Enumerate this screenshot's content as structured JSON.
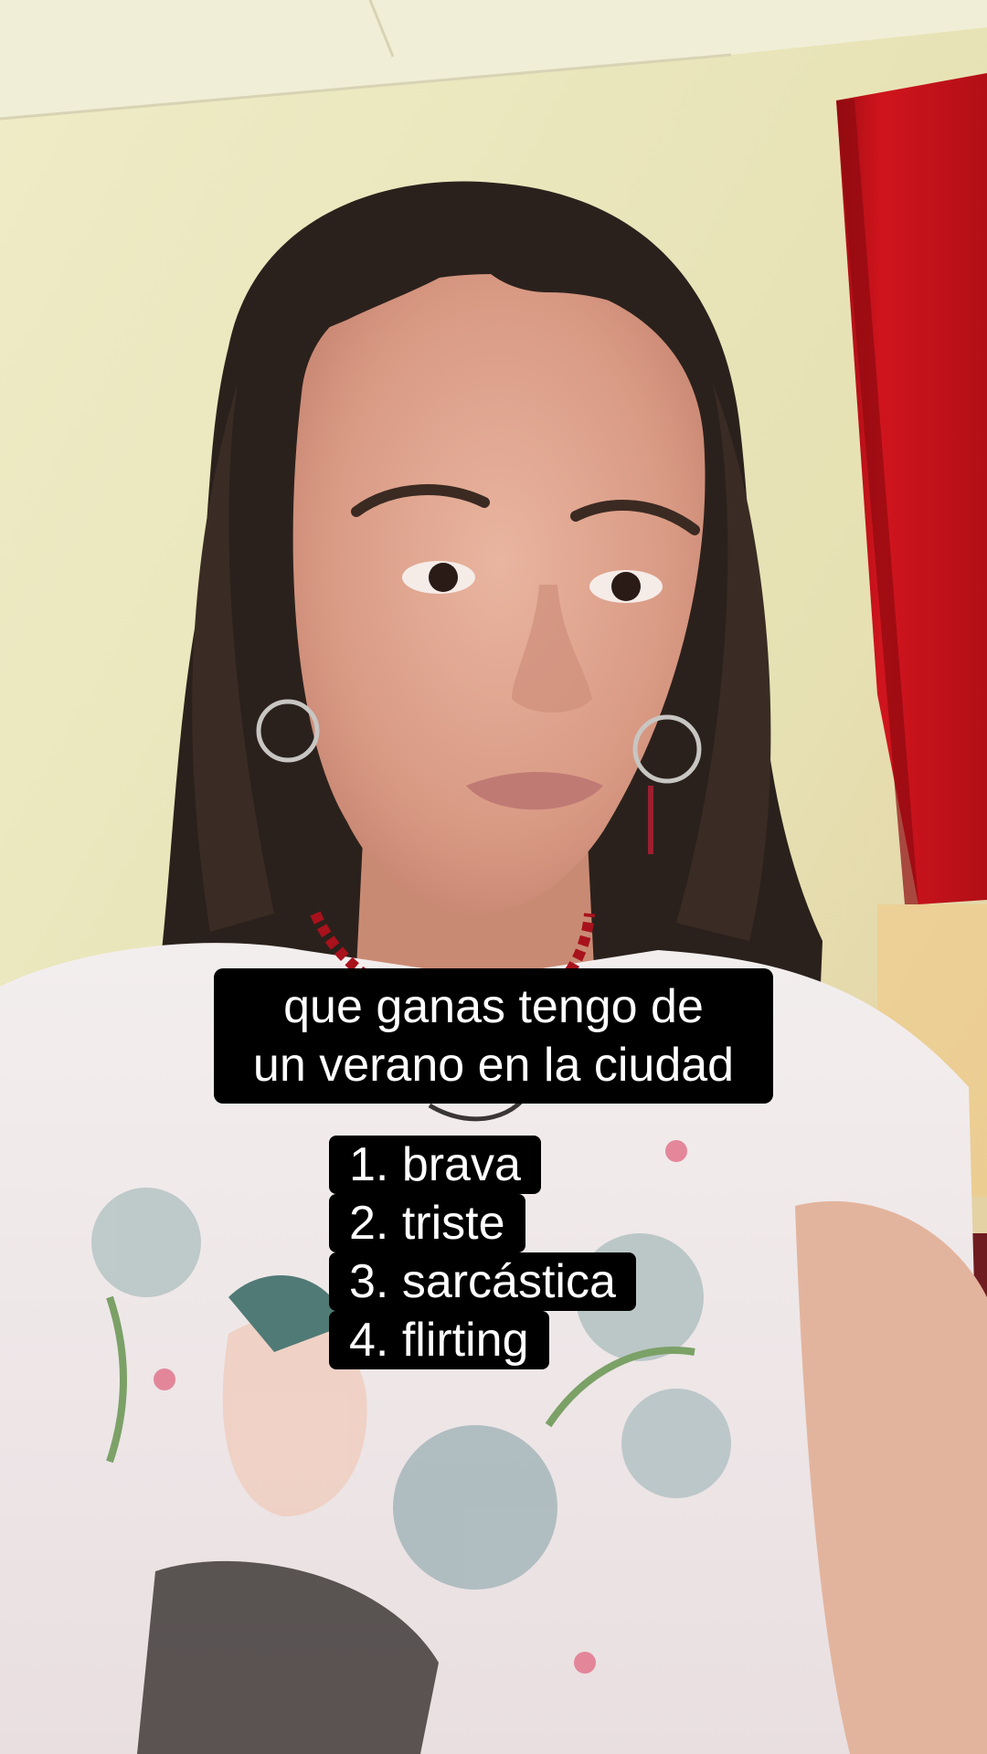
{
  "caption": {
    "line1": "que ganas tengo de",
    "line2": "un verano en la ciudad"
  },
  "list": [
    {
      "text": "1. brava"
    },
    {
      "text": "2. triste"
    },
    {
      "text": "3. sarcástica"
    },
    {
      "text": "4. flirting"
    }
  ],
  "colors": {
    "wall": "#e9e6b8",
    "ceiling": "#eeecd0",
    "red_panel": "#c2121b",
    "hair": "#2b211c",
    "skin": "#d9a08a",
    "shirt": "#f2ecec",
    "caption_bg": "#000000",
    "caption_text": "#ffffff"
  }
}
